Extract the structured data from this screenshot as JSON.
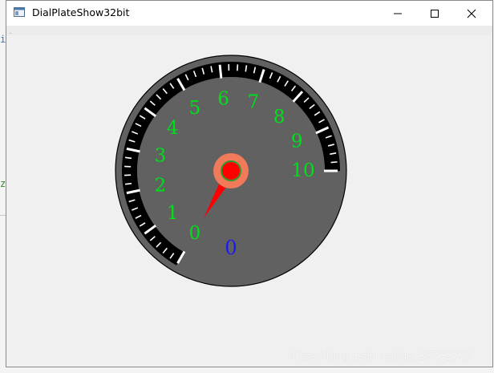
{
  "window": {
    "title": "DialPlateShow32bit",
    "minimize_icon": "minimize-icon",
    "maximize_icon": "maximize-icon",
    "close_icon": "close-icon"
  },
  "background": {
    "left_chars": [
      "i",
      "z"
    ]
  },
  "dial": {
    "scale_labels": [
      "0",
      "1",
      "2",
      "3",
      "4",
      "5",
      "6",
      "7",
      "8",
      "9",
      "10"
    ],
    "scale_min": 0,
    "scale_max": 10,
    "needle_value": 0,
    "readout": "0",
    "colors": {
      "bezel": "#616161",
      "face": "#616161",
      "arc": "#000000",
      "ticks": "#ffffff",
      "labels": "#00e01a",
      "readout": "#1a1aee",
      "needle": "#ff0000",
      "hub_outer": "#f07a5a",
      "hub_inner": "#ff0000",
      "hub_ring": "#2a9b2a"
    }
  },
  "watermark": "https://blog.csdn.net/qq_20792765"
}
